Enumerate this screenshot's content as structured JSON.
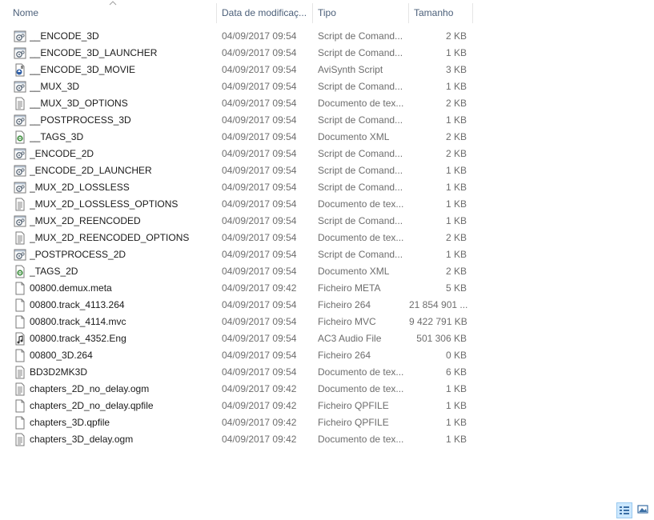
{
  "header": {
    "name": "Nome",
    "date": "Data de modificaç...",
    "type": "Tipo",
    "size": "Tamanho"
  },
  "files": [
    {
      "name": "__ENCODE_3D",
      "date": "04/09/2017 09:54",
      "type": "Script de Comand...",
      "size": "2 KB",
      "icon": "cmd-script-icon"
    },
    {
      "name": "__ENCODE_3D_LAUNCHER",
      "date": "04/09/2017 09:54",
      "type": "Script de Comand...",
      "size": "1 KB",
      "icon": "cmd-script-icon"
    },
    {
      "name": "__ENCODE_3D_MOVIE",
      "date": "04/09/2017 09:54",
      "type": "AviSynth Script",
      "size": "3 KB",
      "icon": "avisynth-icon"
    },
    {
      "name": "__MUX_3D",
      "date": "04/09/2017 09:54",
      "type": "Script de Comand...",
      "size": "1 KB",
      "icon": "cmd-script-icon"
    },
    {
      "name": "__MUX_3D_OPTIONS",
      "date": "04/09/2017 09:54",
      "type": "Documento de tex...",
      "size": "2 KB",
      "icon": "text-doc-icon"
    },
    {
      "name": "__POSTPROCESS_3D",
      "date": "04/09/2017 09:54",
      "type": "Script de Comand...",
      "size": "1 KB",
      "icon": "cmd-script-icon"
    },
    {
      "name": "__TAGS_3D",
      "date": "04/09/2017 09:54",
      "type": "Documento XML",
      "size": "2 KB",
      "icon": "xml-doc-icon"
    },
    {
      "name": "_ENCODE_2D",
      "date": "04/09/2017 09:54",
      "type": "Script de Comand...",
      "size": "2 KB",
      "icon": "cmd-script-icon"
    },
    {
      "name": "_ENCODE_2D_LAUNCHER",
      "date": "04/09/2017 09:54",
      "type": "Script de Comand...",
      "size": "1 KB",
      "icon": "cmd-script-icon"
    },
    {
      "name": "_MUX_2D_LOSSLESS",
      "date": "04/09/2017 09:54",
      "type": "Script de Comand...",
      "size": "1 KB",
      "icon": "cmd-script-icon"
    },
    {
      "name": "_MUX_2D_LOSSLESS_OPTIONS",
      "date": "04/09/2017 09:54",
      "type": "Documento de tex...",
      "size": "1 KB",
      "icon": "text-doc-icon"
    },
    {
      "name": "_MUX_2D_REENCODED",
      "date": "04/09/2017 09:54",
      "type": "Script de Comand...",
      "size": "1 KB",
      "icon": "cmd-script-icon"
    },
    {
      "name": "_MUX_2D_REENCODED_OPTIONS",
      "date": "04/09/2017 09:54",
      "type": "Documento de tex...",
      "size": "2 KB",
      "icon": "text-doc-icon"
    },
    {
      "name": "_POSTPROCESS_2D",
      "date": "04/09/2017 09:54",
      "type": "Script de Comand...",
      "size": "1 KB",
      "icon": "cmd-script-icon"
    },
    {
      "name": "_TAGS_2D",
      "date": "04/09/2017 09:54",
      "type": "Documento XML",
      "size": "2 KB",
      "icon": "xml-doc-icon"
    },
    {
      "name": "00800.demux.meta",
      "date": "04/09/2017 09:42",
      "type": "Ficheiro META",
      "size": "5 KB",
      "icon": "blank-file-icon"
    },
    {
      "name": "00800.track_4113.264",
      "date": "04/09/2017 09:54",
      "type": "Ficheiro 264",
      "size": "21 854 901 ...",
      "icon": "blank-file-icon"
    },
    {
      "name": "00800.track_4114.mvc",
      "date": "04/09/2017 09:54",
      "type": "Ficheiro MVC",
      "size": "9 422 791 KB",
      "icon": "blank-file-icon"
    },
    {
      "name": "00800.track_4352.Eng",
      "date": "04/09/2017 09:54",
      "type": "AC3 Audio File",
      "size": "501 306 KB",
      "icon": "audio-file-icon"
    },
    {
      "name": "00800_3D.264",
      "date": "04/09/2017 09:54",
      "type": "Ficheiro 264",
      "size": "0 KB",
      "icon": "blank-file-icon"
    },
    {
      "name": "BD3D2MK3D",
      "date": "04/09/2017 09:54",
      "type": "Documento de tex...",
      "size": "6 KB",
      "icon": "text-doc-icon"
    },
    {
      "name": "chapters_2D_no_delay.ogm",
      "date": "04/09/2017 09:42",
      "type": "Documento de tex...",
      "size": "1 KB",
      "icon": "text-doc-icon"
    },
    {
      "name": "chapters_2D_no_delay.qpfile",
      "date": "04/09/2017 09:42",
      "type": "Ficheiro QPFILE",
      "size": "1 KB",
      "icon": "blank-file-icon"
    },
    {
      "name": "chapters_3D.qpfile",
      "date": "04/09/2017 09:42",
      "type": "Ficheiro QPFILE",
      "size": "1 KB",
      "icon": "blank-file-icon"
    },
    {
      "name": "chapters_3D_delay.ogm",
      "date": "04/09/2017 09:42",
      "type": "Documento de tex...",
      "size": "1 KB",
      "icon": "text-doc-icon"
    }
  ],
  "view_buttons": {
    "details": {
      "icon": "details-view-icon",
      "selected": true
    },
    "thumbnails": {
      "icon": "large-icons-view-icon",
      "selected": false
    }
  },
  "colors": {
    "header_text": "#4c607a",
    "secondary_text": "#6d6d6d",
    "selected_view_bg": "#cce8ff"
  }
}
